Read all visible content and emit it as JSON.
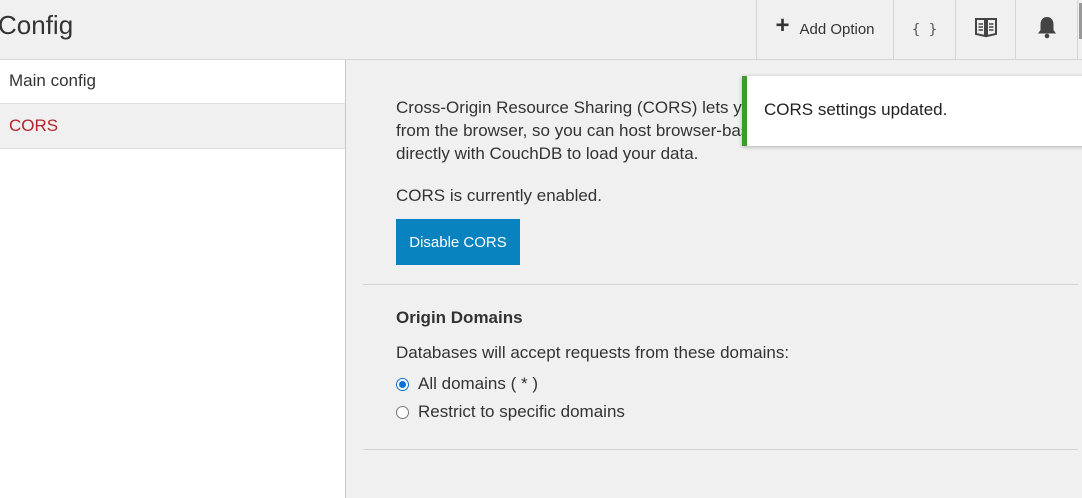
{
  "header": {
    "title": "Config",
    "add_option_label": "Add Option",
    "json_label": "{ }",
    "icons": [
      "plus-icon",
      "json-braces-icon",
      "book-icon",
      "bell-icon"
    ]
  },
  "sidebar": {
    "items": [
      {
        "label": "Main config",
        "active": false
      },
      {
        "label": "CORS",
        "active": true
      }
    ]
  },
  "main": {
    "intro_lines": [
      "Cross-Origin Resource Sharing (CORS) lets you connect to remote servers directly",
      "from the browser, so you can host browser-based apps on static pages and talk",
      "directly with CouchDB to load your data."
    ],
    "status_text": "CORS is currently enabled.",
    "disable_button_label": "Disable CORS",
    "origin_title": "Origin Domains",
    "origin_desc": "Databases will accept requests from these domains:",
    "options": [
      {
        "label": "All domains ( * )",
        "checked": true
      },
      {
        "label": "Restrict to specific domains",
        "checked": false
      }
    ]
  },
  "toast": {
    "message": "CORS settings updated."
  },
  "colors": {
    "accent": "#0883c0",
    "active_nav": "#b3242a",
    "toast_border": "#3d9b2b"
  }
}
